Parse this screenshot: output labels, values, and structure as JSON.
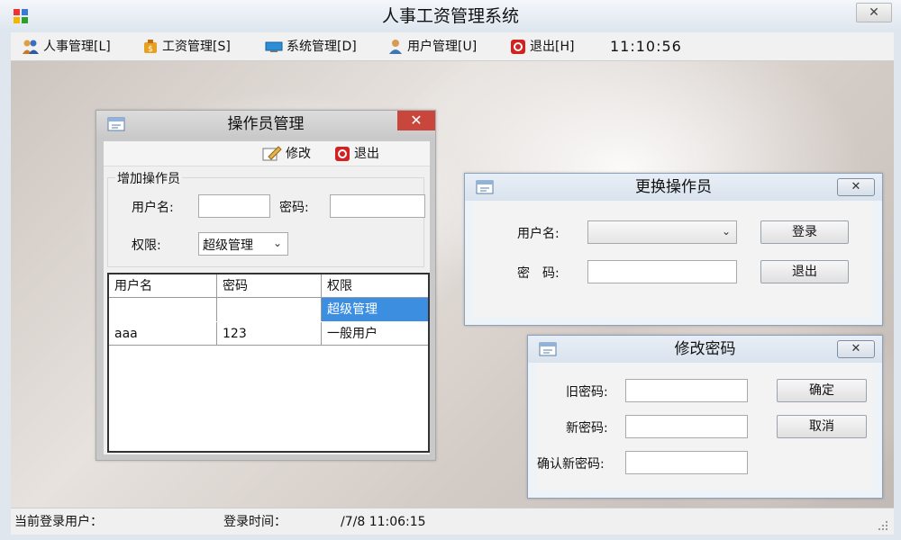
{
  "window": {
    "title": "人事工资管理系统",
    "close_glyph": "✕"
  },
  "menu": {
    "items": [
      {
        "label": "人事管理[L]",
        "icon": "people-icon"
      },
      {
        "label": "工资管理[S]",
        "icon": "money-bag-icon"
      },
      {
        "label": "系统管理[D]",
        "icon": "monitor-icon"
      },
      {
        "label": "用户管理[U]",
        "icon": "user-icon"
      },
      {
        "label": "退出[H]",
        "icon": "exit-icon"
      }
    ],
    "clock": "11:10:56"
  },
  "status": {
    "current_user_label": "当前登录用户：",
    "login_time_label": "登录时间：",
    "login_time_value": "/7/8 11:06:15"
  },
  "operator_dialog": {
    "title": "操作员管理",
    "close_glyph": "✕",
    "toolbar": {
      "edit": "修改",
      "exit": "退出"
    },
    "add_group": {
      "legend": "增加操作员",
      "username_label": "用户名:",
      "username_value": "",
      "password_label": "密码:",
      "password_value": "",
      "permission_label": "权限:",
      "permission_value": "超级管理"
    },
    "table": {
      "columns": [
        "用户名",
        "密码",
        "权限"
      ],
      "rows": [
        {
          "username": "",
          "password": "",
          "permission": "超级管理",
          "selected": true
        },
        {
          "username": "aaa",
          "password": "123",
          "permission": "一般用户",
          "selected": false
        }
      ]
    }
  },
  "switch_dialog": {
    "title": "更换操作员",
    "close_glyph": "✕",
    "username_label": "用户名:",
    "username_value": "",
    "password_label": "密　码:",
    "password_value": "",
    "login_button": "登录",
    "exit_button": "退出"
  },
  "password_dialog": {
    "title": "修改密码",
    "close_glyph": "✕",
    "old_label": "旧密码:",
    "new_label": "新密码:",
    "confirm_label": "确认新密码:",
    "old_value": "",
    "new_value": "",
    "confirm_value": "",
    "ok_button": "确定",
    "cancel_button": "取消"
  },
  "colors": {
    "selection": "#3b8ee0",
    "close_red": "#c9463d",
    "dialog_border": "#8aa2c0"
  }
}
